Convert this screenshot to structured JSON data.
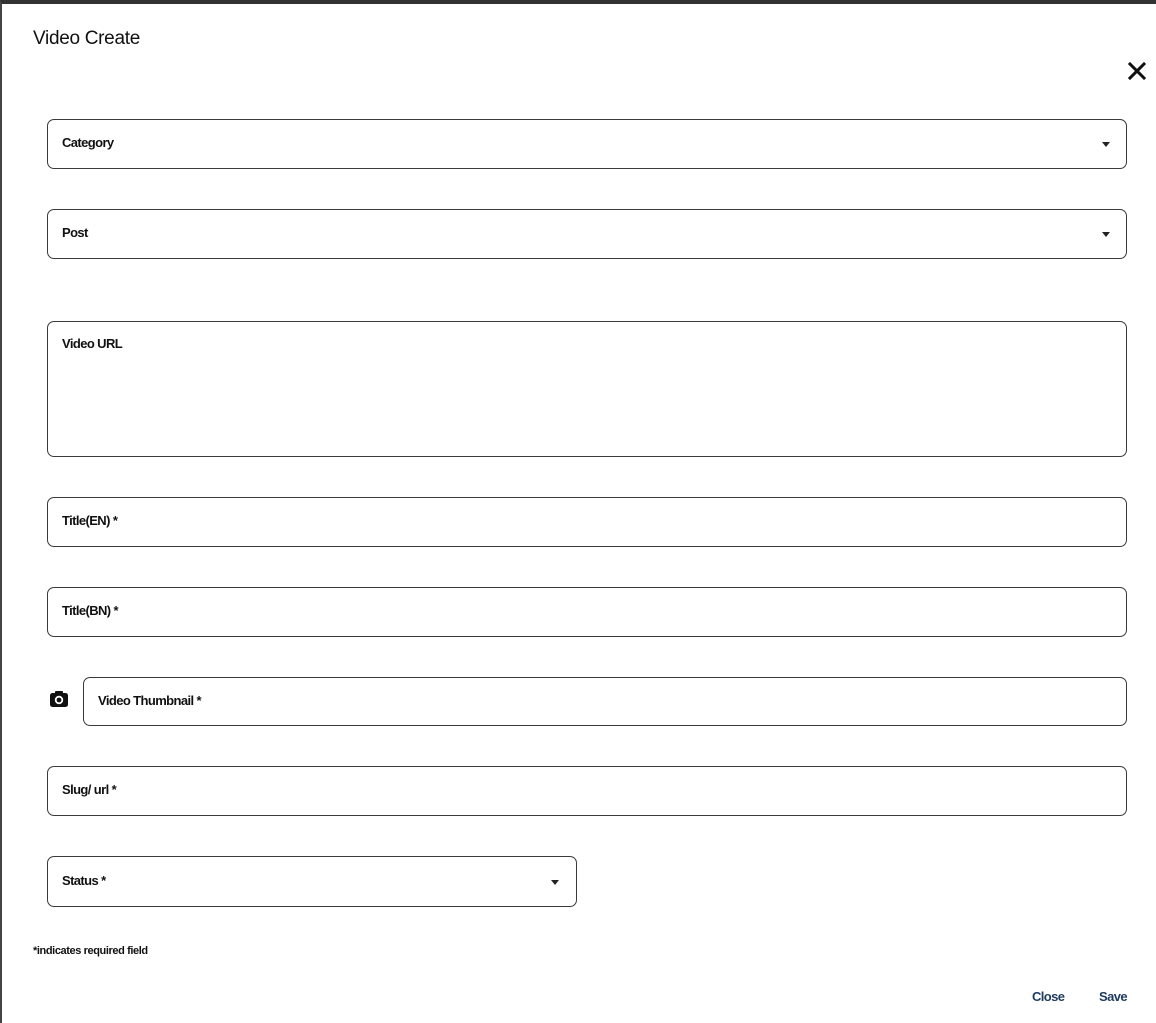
{
  "dialog": {
    "title": "Video Create",
    "close_icon": "close-icon"
  },
  "form": {
    "category": {
      "label": "Category",
      "icon": "chevron-down-icon"
    },
    "post": {
      "label": "Post",
      "icon": "chevron-down-icon"
    },
    "video_url": {
      "label": "Video URL"
    },
    "title_en": {
      "label": "Title(EN) *"
    },
    "title_bn": {
      "label": "Title(BN) *"
    },
    "video_thumbnail": {
      "label": "Video Thumbnail *",
      "icon": "camera-icon"
    },
    "slug": {
      "label": "Slug/ url *"
    },
    "status": {
      "label": "Status *",
      "icon": "chevron-down-icon"
    }
  },
  "footer": {
    "required_note": "*indicates required field",
    "close_label": "Close",
    "save_label": "Save"
  },
  "colors": {
    "border": "#3a3a3a",
    "button_text": "#1f3a5f"
  }
}
